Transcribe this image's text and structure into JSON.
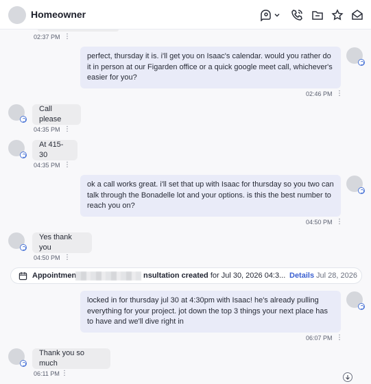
{
  "header": {
    "title": "Homeowner"
  },
  "header_icons": [
    "chat-assign-icon",
    "chevron-down-icon",
    "phone-icon",
    "folder-icon",
    "star-icon",
    "mail-open-icon"
  ],
  "messages": [
    {
      "direction": "in",
      "text": "",
      "time": "02:37 PM"
    },
    {
      "direction": "out",
      "text": "perfect, thursday it is. i'll get you on Isaac's calendar. would you rather do it in person at our Figarden office or a quick google meet call, whichever's easier for you?",
      "time": "02:46 PM"
    },
    {
      "direction": "in",
      "text": "Call please",
      "time": "04:35 PM"
    },
    {
      "direction": "in",
      "text": "At 415-30",
      "time": "04:35 PM"
    },
    {
      "direction": "out",
      "text": "ok a call works great. i'll set that up with Isaac for thursday so you two can talk through the Bonadelle lot and your options. is this the best number to reach you on?",
      "time": "04:50 PM"
    },
    {
      "direction": "in",
      "text": "Yes thank you",
      "time": "04:50 PM"
    },
    {
      "direction": "out",
      "text": "locked in for thursday jul 30 at 4:30pm with Isaac! he's already pulling everything for your project. jot down the top 3 things your next place has to have and we'll dive right in",
      "time": "06:07 PM"
    },
    {
      "direction": "in",
      "text": "Thank you so much",
      "time": "06:11 PM"
    }
  ],
  "event": {
    "label_start": "Appointment",
    "label_end": "nsultation created",
    "detail": "for Jul 30, 2026 04:3...",
    "details_link": "Details",
    "date": "Jul 28, 2026"
  },
  "colors": {
    "outgoing_bubble": "#e9ebf8",
    "incoming_bubble": "#ececee",
    "accent": "#3a5fd0"
  }
}
